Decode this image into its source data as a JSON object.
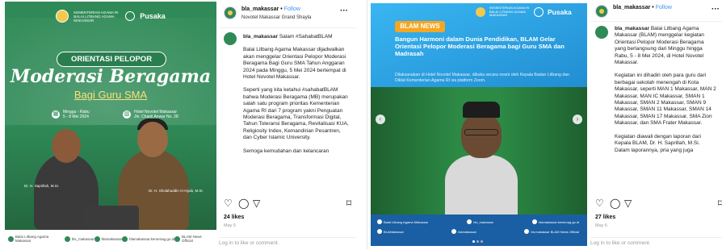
{
  "post1": {
    "image": {
      "org_small": "KEMENTERIAN AGAMA RI BALAI LITBANG AGAMA MAKASSAR",
      "brand": "Pusaka",
      "pill": "ORIENTASI PELOPOR",
      "title": "Moderasi Beragama",
      "subtitle": "Bagi Guru SMA",
      "date_info": "Minggu - Rabu\n5 - 8 Mei 2024",
      "place_info": "Hotel Novotel Makassar\nJln. Chairil Anwar No. 28",
      "speaker1": "Dr. H. Saprillah, M.Si.",
      "speaker2": "Dr. H. Sholahuddin Al Aiyub, M.Si.",
      "footer": [
        "Balai Litbang Agama Makassar",
        "blv_makassar",
        "blamakassar",
        "blamakassar.kemenag.go.id",
        "BLAM News Official"
      ]
    },
    "header": {
      "username": "bla_makassar",
      "follow": "Follow",
      "location": "Novotel Makassar Grand Shayla",
      "more": "···"
    },
    "caption": {
      "lead_user": "bla_makassar",
      "lead_text": "Salam #SahabatBLAM",
      "p1": "Balai Litbang Agama Makassar dijadwalkan akan menggelar Orientasi Pelopor Moderasi Beragama Bagi Guru SMA Tahun Anggaran 2024 pada Minggu, 5 Mei 2024 bertempat di Hotel Novotel Makassar.",
      "p2": "Seperti yang kita ketahui #sahabatBLAM bahwa Moderasi Beragama (MB) merupakan salah satu program prioritas Kementerian Agama RI dari 7 program yakni Penguatan Moderasi Beragama, Transformasi Digital, Tahun Toleransi Beragama, Revitalisasi KUA, Religiosity Index, Kemandirian Pesantren, dan Cyber Islamic University.",
      "p3": "Semoga kemudahan dan kelancaran"
    },
    "likes": "24 likes",
    "date": "May 5",
    "login": "Log in to like or comment."
  },
  "post2": {
    "image": {
      "org_small": "KEMENTERIAN AGAMA RI BALAI LITBANG AGAMA MAKASSAR",
      "brand": "Pusaka",
      "pill": "BLAM NEWS",
      "headline": "Bangun Harmoni dalam Dunia Pendidikan, BLAM Gelar Orientasi Pelopor Moderasi Beragama bagi Guru SMA dan Madrasah",
      "subline": "Dilaksanakan di Hotel Novotel Makassar, dibuka secara resmi oleh Kepala Badan Litbang dan Diklat Kementerian Agama RI via platform Zoom.",
      "footer_row1": [
        "Balai Litbang Agama Makassar",
        "blv_makassar",
        "blamakassar.kemenag.go.id"
      ],
      "footer_row2": [
        "BLAMakassar",
        "blamakassar",
        "blv.makassar BLAM News Official"
      ]
    },
    "header": {
      "username": "bla_makassar",
      "follow": "Follow",
      "more": "···"
    },
    "caption": {
      "lead_user": "bla_makassar",
      "p1": "Balai Litbang Agama Makassar (BLAM) menggelar kegiatan Orientasi Pelopor Moderasi Beragama yang berlangsung dari Minggu hingga Rabu, 5 - 8 Mei 2024, di Hotel Novotel Makassar.",
      "p2": "Kegiatan ini dihadiri oleh para guru dari berbagai sekolah menengah di Kota Makassar, seperti MAN 1 Makassar, MAN 2 Makassar, MAN IC Makassar, SMAN 1 Makassar, SMAN 2 Makassar, SMAN 9 Makassar, SMAN 11 Makassar, SMAN 14 Makassar, SMAN 17 Makassar, SMA Zion Makassar, dan SMA Frater Makassar.",
      "p3": "Kegiatan diawali dengan laporan dari Kepala BLAM, Dr. H. Saprillah, M.Si. Dalam laporannya, pria yang juga"
    },
    "likes": "27 likes",
    "date": "May 6",
    "login": "Log in to like or comment."
  },
  "icons": {
    "heart": "♡",
    "comment": "◯",
    "share": "▽",
    "bookmark": "⌑",
    "arrow_left": "‹",
    "arrow_right": "›"
  }
}
